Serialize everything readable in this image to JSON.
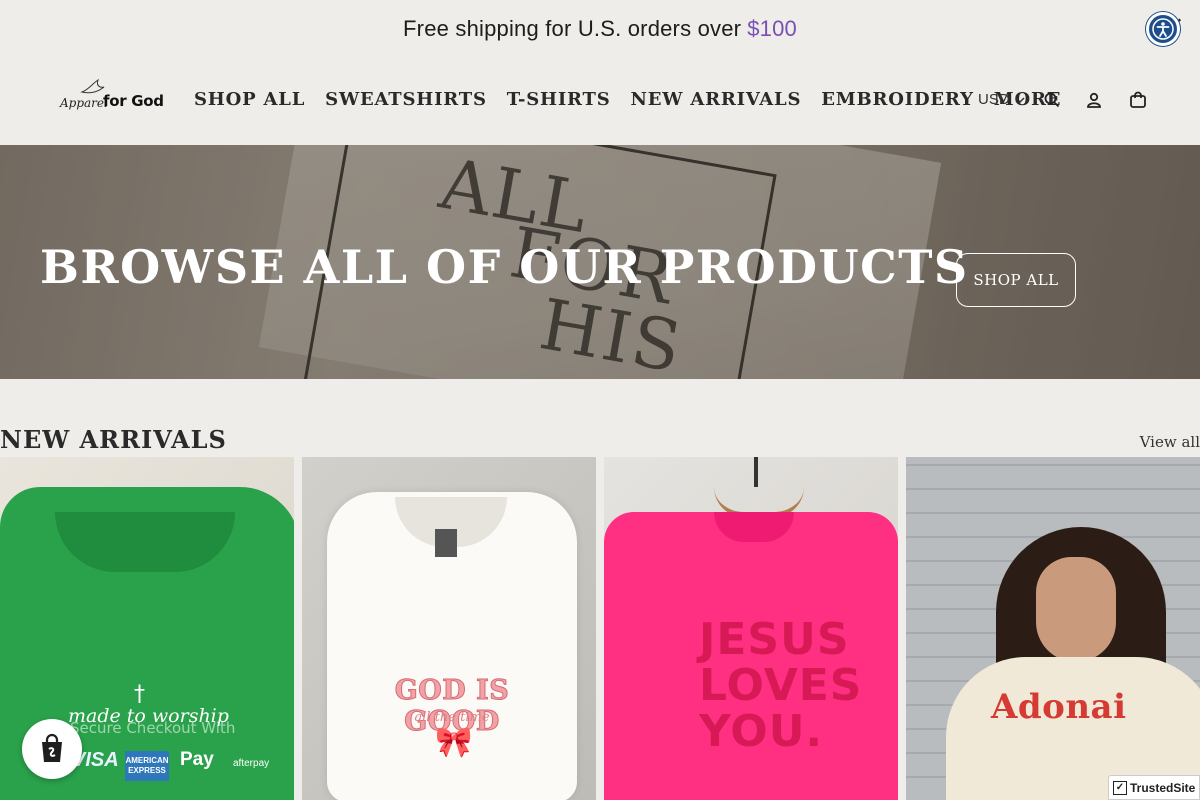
{
  "announcement": {
    "text": "Free shipping for U.S. orders over",
    "amount": "$100",
    "close_glyph": "✕"
  },
  "header": {
    "logo_line1": "Apparel",
    "logo_line2": "for God",
    "nav": [
      "SHOP ALL",
      "SWEATSHIRTS",
      "T-SHIRTS",
      "NEW ARRIVALS",
      "EMBROIDERY",
      "MORE"
    ],
    "currency": "USD",
    "icons": [
      "search-icon",
      "account-icon",
      "cart-icon"
    ]
  },
  "hero": {
    "heading": "BROWSE ALL OF OUR PRODUCTS",
    "button": "SHOP ALL"
  },
  "new_arrivals": {
    "title": "NEW ARRIVALS",
    "view_all": "View all",
    "products": [
      {
        "print_cross": "†",
        "print_text": "made to worship",
        "overlay_text": "Secure Checkout With",
        "payments": [
          "VISA",
          "AMERICAN EXPRESS",
          " Pay",
          "afterpay"
        ]
      },
      {
        "print_text": "GOD IS GOOD",
        "print_sub": "all the time",
        "print_bow": "🎀"
      },
      {
        "print_text": "JESUS LOVES YOU."
      },
      {
        "print_text": "Adonai"
      }
    ]
  },
  "widgets": {
    "trusted": "TrustedSite",
    "trusted_check": "✓"
  },
  "colors": {
    "background": "#efede9",
    "accent_amount": "#7b4fb4",
    "accessibility_button": "#1d4e8c"
  }
}
